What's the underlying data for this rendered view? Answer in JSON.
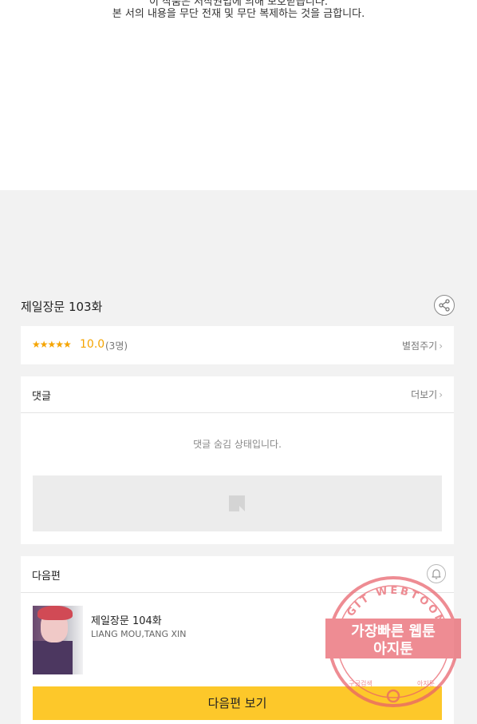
{
  "notice": {
    "line1": "이 작품은 저작권법에 의해 보호받습니다.",
    "line2": "본 서의 내용을 무단 전재 및 무단 복제하는 것을 금합니다."
  },
  "episode": {
    "title": "제일장문 103화"
  },
  "rating": {
    "stars": "★★★★★",
    "score": "10.0",
    "count": "(3명)",
    "rate_label": "별점주기"
  },
  "comments": {
    "title": "댓글",
    "more_label": "더보기",
    "hidden_message": "댓글 숨김 상태입니다."
  },
  "next_episode": {
    "section_title": "다음편",
    "title": "제일장문 104화",
    "author": "LIANG MOU,TANG XIN",
    "button_label": "다음편 보기"
  },
  "watermark": {
    "arc_text": "AGIT WEBTOON",
    "line1": "가장빠른 웹툰",
    "line2": "아지툰",
    "bottom_left": "구글검색",
    "bottom_right": "아지툰",
    "color": "#e8606a"
  },
  "colors": {
    "accent_yellow": "#fdc82a",
    "star_orange": "#f5a400"
  },
  "icons": {
    "share": "share-icon",
    "bell": "bell-icon",
    "chevron": "chevron-right-icon"
  }
}
